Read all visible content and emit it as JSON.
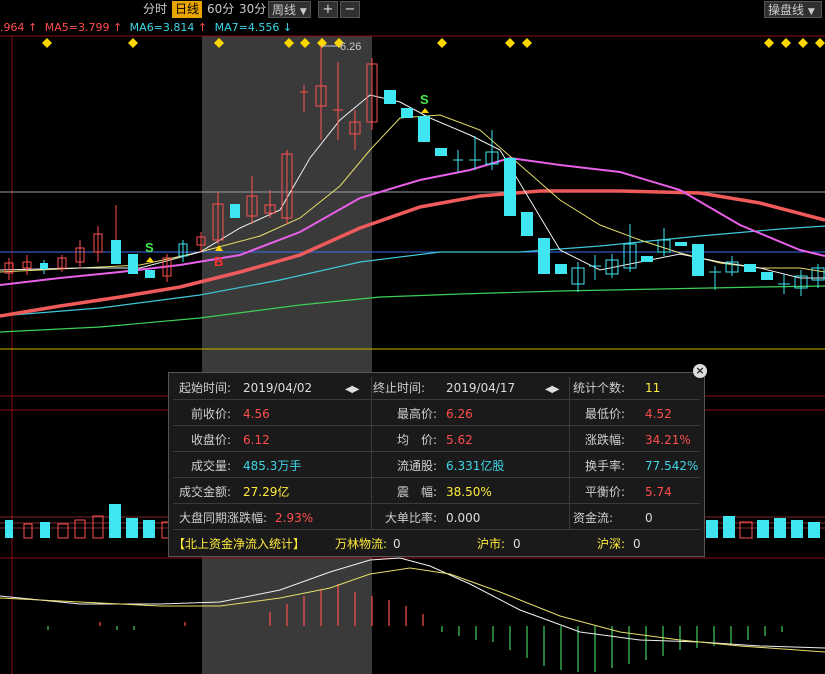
{
  "toolbar": {
    "periods": [
      "分时",
      "日线",
      "60分",
      "30分",
      "周线"
    ],
    "selected_period": "日线",
    "dropdown_arrow": "chevron-down-icon",
    "zoom_in": "+",
    "zoom_out": "−",
    "right_menu": "操盘线"
  },
  "ma_line": {
    "partial": ".964",
    "ma5": "MA5=3.799",
    "ma6": "MA6=3.814",
    "ma7": "MA7=4.556",
    "up_arrow": "↑",
    "down_arrow": "↓",
    "colors": {
      "partial": "#ff4d4d",
      "ma5": "#ff4d4d",
      "ma6": "#3fd6e8",
      "ma7": "#3fd6e8"
    }
  },
  "chart_labels": {
    "high_price": "6.26",
    "signals": [
      "S",
      "B",
      "S"
    ]
  },
  "stats_popup": {
    "start_time_label": "起始时间:",
    "start_time": "2019/04/02",
    "end_time_label": "终止时间:",
    "end_time": "2019/04/17",
    "count_label": "统计个数:",
    "count": "11",
    "prev_close_label": "前收价:",
    "prev_close": "4.56",
    "high_label": "最高价:",
    "high": "6.26",
    "low_label": "最低价:",
    "low": "4.52",
    "close_label": "收盘价:",
    "close": "6.12",
    "avg_label": "均　价:",
    "avg": "5.62",
    "change_label": "涨跌幅:",
    "change": "34.21%",
    "volume_label": "成交量:",
    "volume": "485.3万手",
    "float_label": "流通股:",
    "float_shares": "6.331亿股",
    "turnover_label": "换手率:",
    "turnover": "77.542%",
    "amount_label": "成交金额:",
    "amount": "27.29亿",
    "amplitude_label": "震　幅:",
    "amplitude": "38.50%",
    "balance_label": "平衡价:",
    "balance": "5.74",
    "market_change_label": "大盘同期涨跌幅:",
    "market_change": "2.93%",
    "big_order_label": "大单比率:",
    "big_order": "0.000",
    "fund_flow_label": "资金流:",
    "fund_flow": "0",
    "northbound_title": "【北上资金净流入统计】",
    "wanlin_label": "万林物流:",
    "wanlin": "0",
    "hushi_label": "沪市:",
    "hushi": "0",
    "hushen_label": "沪深:",
    "hushen": "0",
    "close_icon": "close-icon"
  }
}
